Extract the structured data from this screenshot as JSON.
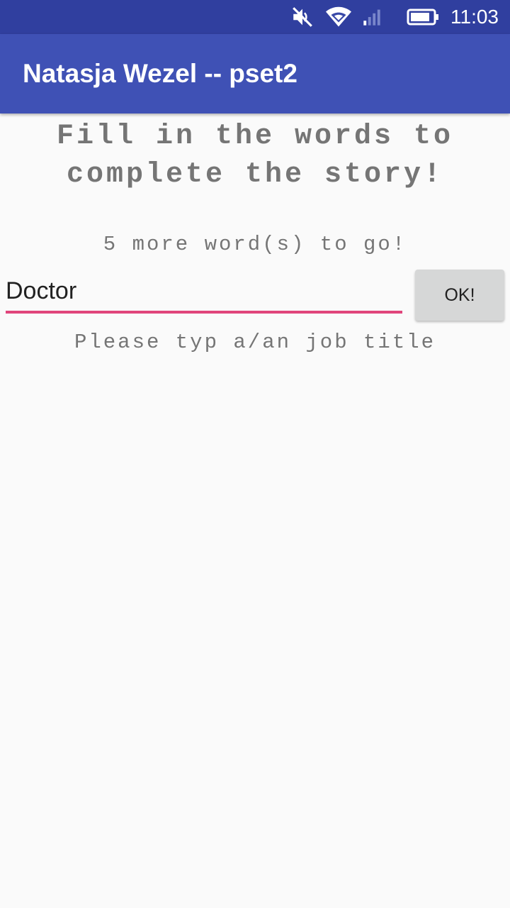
{
  "status_bar": {
    "time": "11:03",
    "icons": [
      "mute-icon",
      "wifi-icon",
      "signal-icon",
      "battery-icon"
    ]
  },
  "app_bar": {
    "title": "Natasja Wezel -- pset2"
  },
  "main": {
    "heading_line1": "Fill in the words to",
    "heading_line2": "complete the story!",
    "remaining": "5 more word(s) to go!",
    "word_input_value": "Doctor",
    "ok_label": "OK!",
    "hint": "Please typ a/an job title"
  },
  "colors": {
    "status_bar": "#303f9f",
    "app_bar": "#3f51b5",
    "accent": "#e0457b",
    "background": "#fafafa"
  }
}
